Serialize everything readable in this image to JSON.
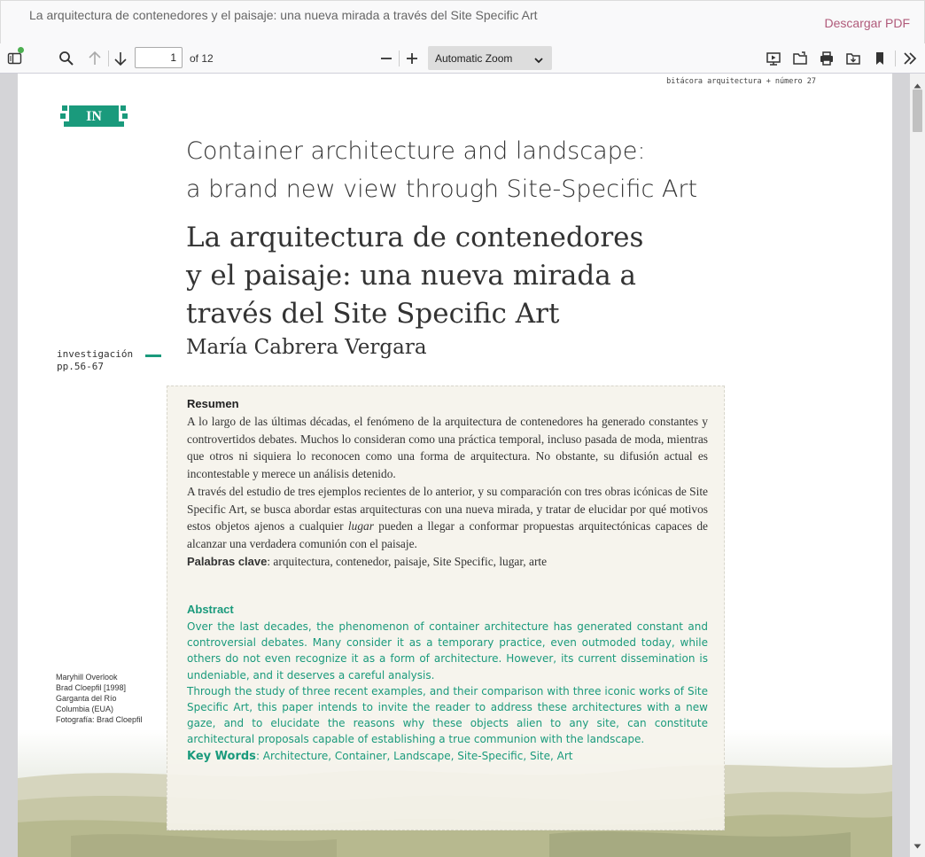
{
  "header": {
    "doc_title": "La arquitectura de contenedores y el paisaje: una nueva mirada a través del Site Specific Art",
    "download_label": "Descargar PDF"
  },
  "toolbar": {
    "page_number": "1",
    "page_count_label": "of 12",
    "zoom_value": "Automatic Zoom"
  },
  "page": {
    "journal_header": "bitácora arquitectura + número 27",
    "badge": "IN",
    "title_en_line1": "Container architecture and landscape:",
    "title_en_line2": "a brand new view through Site-Specific Art",
    "title_es_line1": "La arquitectura de contenedores",
    "title_es_line2": "y el paisaje: una nueva mirada a",
    "title_es_line3": "través del Site Specific Art",
    "author": "María Cabrera Vergara",
    "section_line1": "investigación",
    "section_line2": "pp.56-67",
    "caption": [
      "Maryhill Overlook",
      "Brad Cloepfil [1998]",
      "Garganta del Río",
      "Columbia (EUA)",
      "Fotografía: Brad Cloepfil"
    ],
    "resumen": {
      "heading": "Resumen",
      "p1a": "A lo largo de las últimas décadas, el fenómeno de la arquitectura de contenedores ha generado constantes y controvertidos debates. Muchos lo consideran como una práctica temporal, incluso pasada de moda, mientras que otros ni siquiera lo reconocen como una forma de arquitectura. No obstante, su difusión actual es incontestable y merece un análisis detenido.",
      "p2a": "A través del estudio de tres ejemplos recientes de lo anterior, y su comparación con tres obras icónicas de Site Specific Art, se busca abordar estas arquitecturas con una nueva mirada, y tratar de elucidar por qué motivos estos objetos ajenos a cualquier ",
      "p2_italic": "lugar",
      "p2b": " pueden a llegar a conformar propuestas arquitectónicas capaces de alcanzar una verdadera comunión con el paisaje.",
      "keywords_label": "Palabras clave",
      "keywords": ": arquitectura, contenedor, paisaje, Site Specific, lugar, arte"
    },
    "abstract": {
      "heading": "Abstract",
      "p1": "Over the last decades, the phenomenon of container architecture has generated constant and controversial debates. Many consider it as a temporary practice, even outmoded today, while others do not even recognize it as a form of architecture. However, its current dissemination is undeniable, and it deserves a careful analysis.",
      "p2": "Through the study of three recent examples, and their comparison with three iconic works of Site Specific Art, this paper intends to invite the reader to address these architectures with a new gaze, and to elucidate the reasons why these objects alien to any site, can constitute architectural proposals capable of establishing a true communion with the landscape.",
      "keywords_label": "Key Words",
      "keywords": ": Architecture, Container, Landscape, Site-Specific, Site, Art"
    }
  },
  "colors": {
    "accent": "#1a9a7c",
    "download": "#b05a7a",
    "abstract_bg": "#f5f3ec"
  },
  "icons": [
    "sidebar-toggle-icon",
    "search-icon",
    "arrow-up-icon",
    "arrow-down-icon",
    "minus-icon",
    "plus-icon",
    "chevron-down-icon",
    "presentation-icon",
    "open-file-icon",
    "print-icon",
    "save-icon",
    "bookmark-icon",
    "double-chevron-right-icon"
  ]
}
